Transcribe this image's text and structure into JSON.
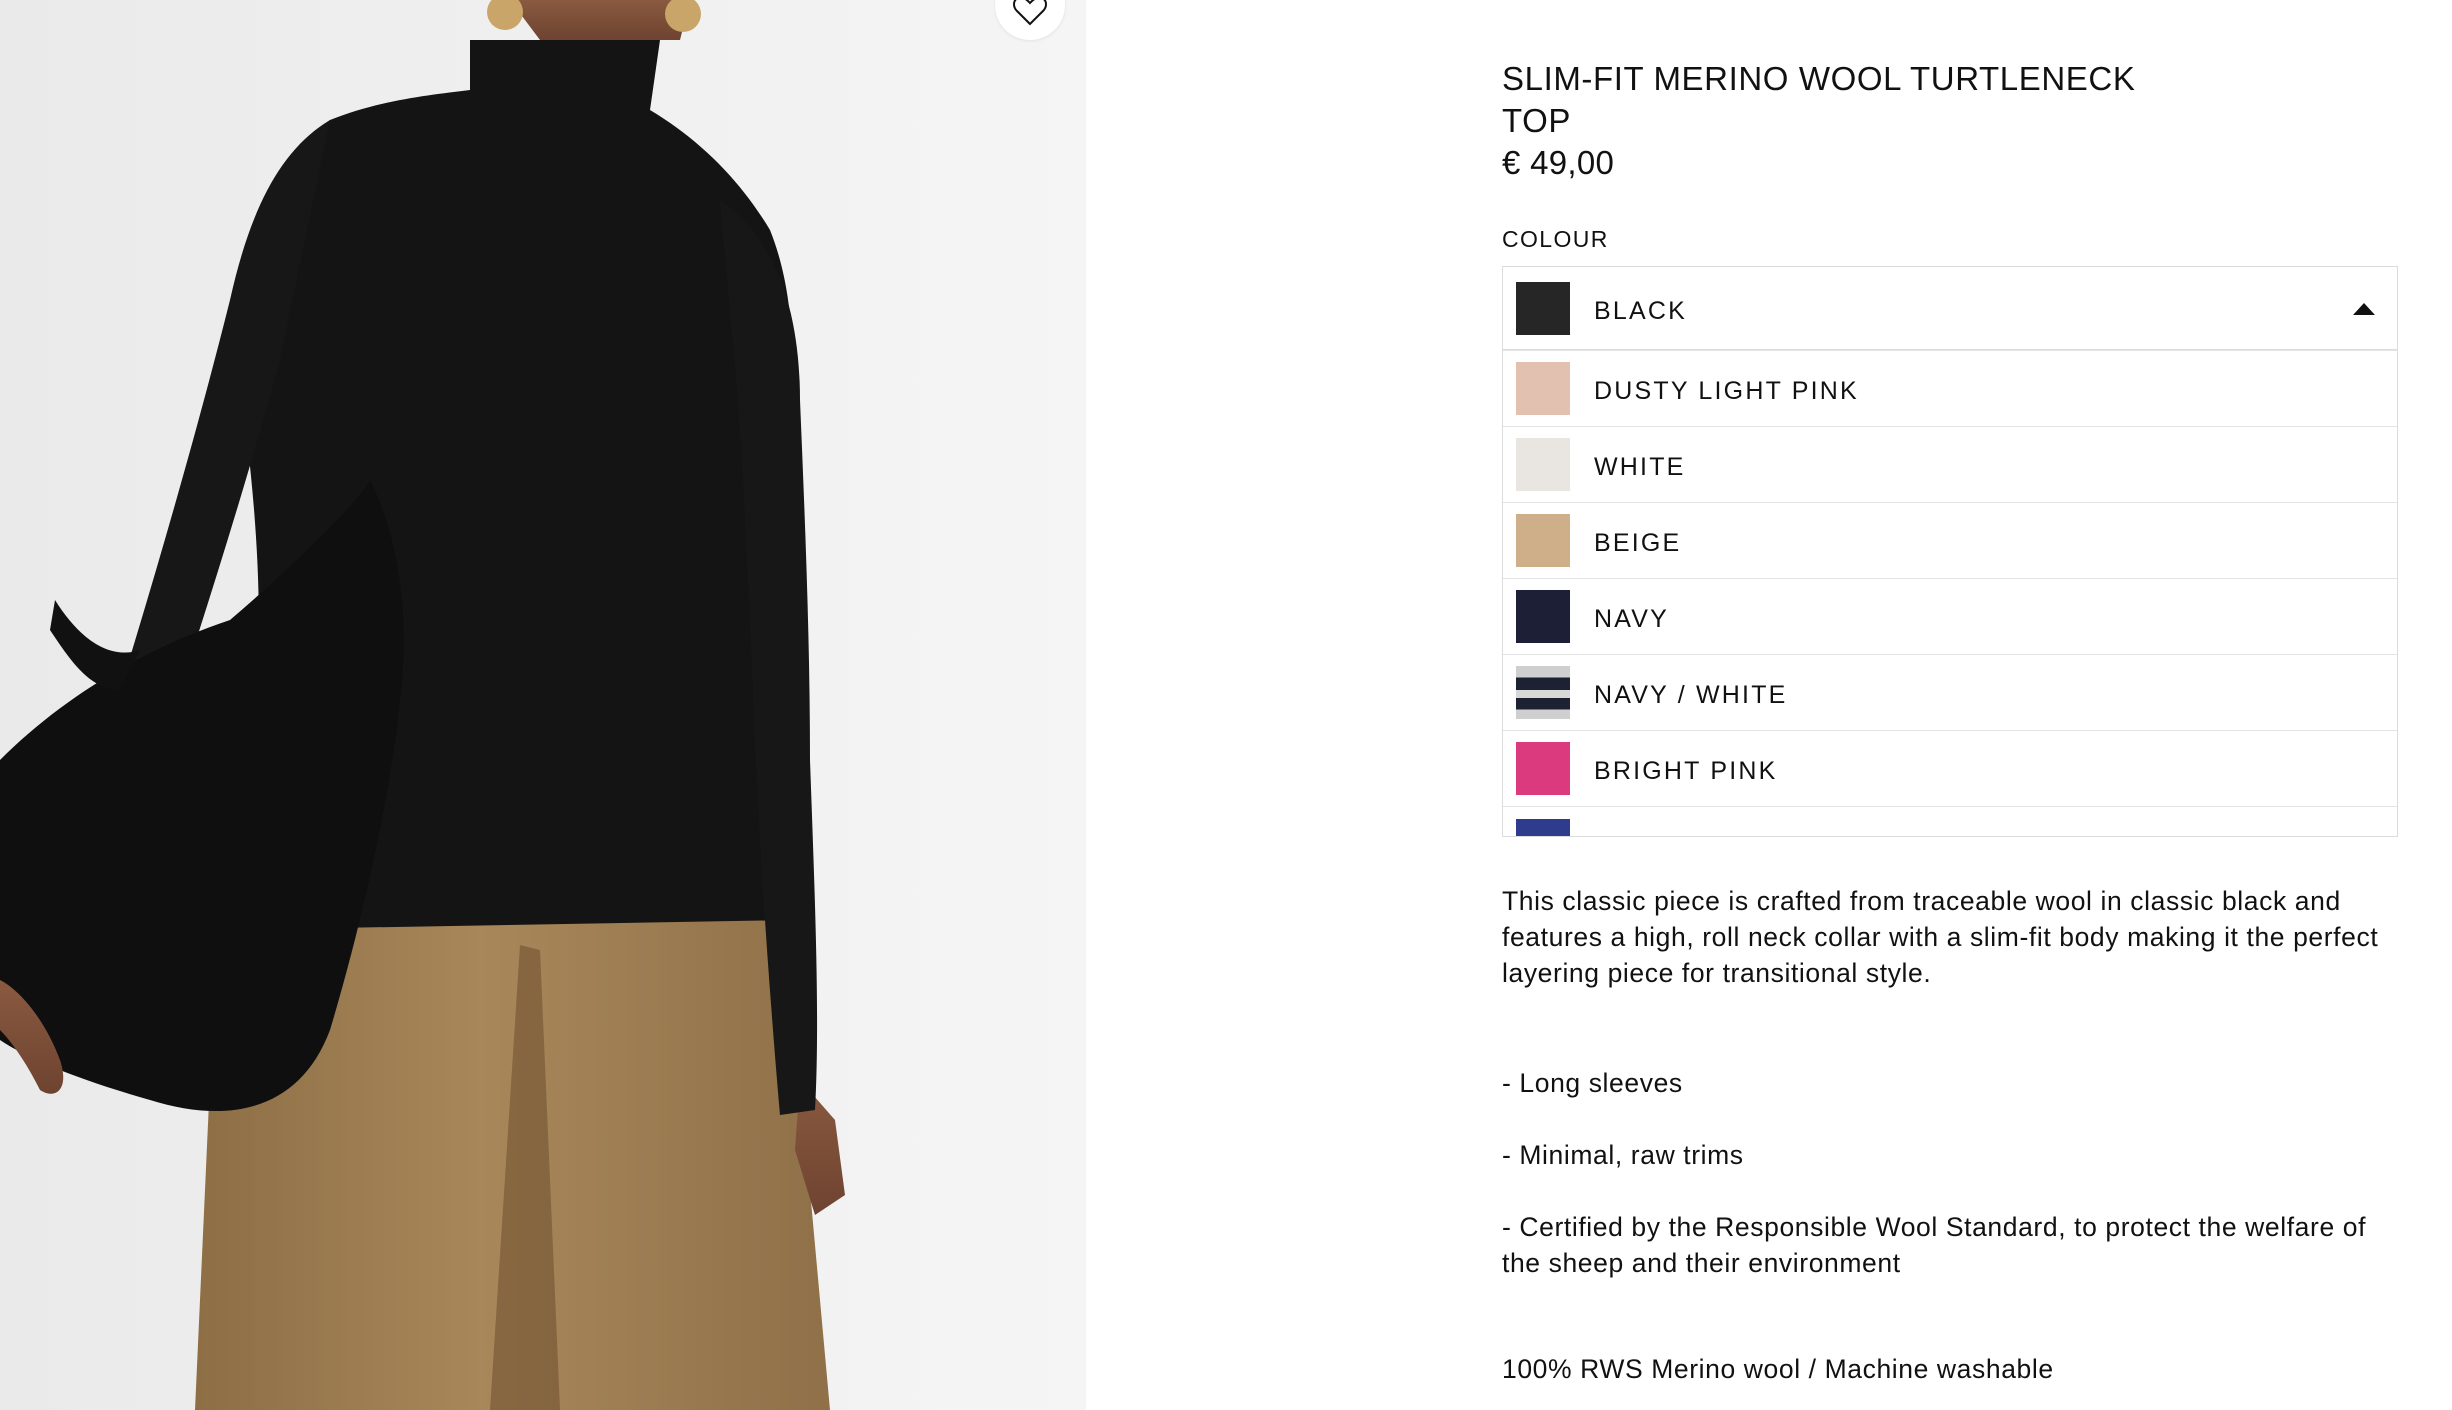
{
  "product": {
    "title": "SLIM-FIT MERINO WOOL TURTLENECK TOP",
    "price": "€ 49,00"
  },
  "colour": {
    "label": "COLOUR",
    "selected": {
      "name": "BLACK",
      "swatch": "#262626"
    },
    "options": [
      {
        "name": "DUSTY LIGHT PINK",
        "swatch": "#e2c1b0"
      },
      {
        "name": "WHITE",
        "swatch": "#e9e6e1"
      },
      {
        "name": "BEIGE",
        "swatch": "#cfae8a"
      },
      {
        "name": "NAVY",
        "swatch": "#1c1f35"
      },
      {
        "name": "NAVY / WHITE",
        "swatch": "#1d2233"
      },
      {
        "name": "BRIGHT PINK",
        "swatch": "#db3a7e"
      }
    ],
    "partial_swatch": "#2f3b8c"
  },
  "description": "This classic piece is crafted from traceable wool in classic black and features a high, roll neck collar with a slim-fit body making it the perfect layering piece for transitional style.",
  "features": [
    "- Long sleeves",
    "- Minimal, raw trims",
    "- Certified by the Responsible Wool Standard, to protect the welfare of the sheep and their environment"
  ],
  "composition": "100% RWS Merino wool / Machine washable",
  "icons": {
    "wishlist": "heart-outline-icon",
    "dropdown": "caret-up-icon"
  }
}
